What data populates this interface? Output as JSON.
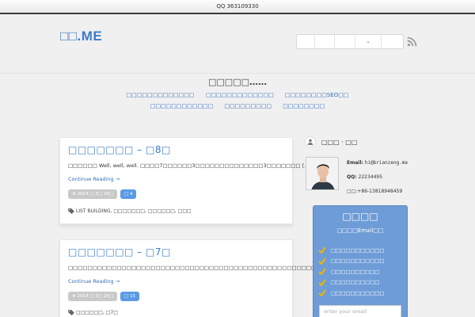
{
  "topbar": {
    "text": "QQ   363109330"
  },
  "header": {
    "logo": "□□.ME",
    "menu_chevron": "⌄"
  },
  "intro": {
    "title": "□□□□□……",
    "links_row1": [
      "□□□□□□□□□□□□□",
      "□□□□□□□□□□□□□",
      "□□□□□□□□SEO□□"
    ],
    "links_row2": [
      "□□□□□□□□□□□□",
      "□□□□□□□□□",
      "□□□□□□□□"
    ]
  },
  "posts": [
    {
      "title": "□□□□□□□ – □8□",
      "excerpt": "□□□□□□ Well, well, well. □□□□7□□□□□□3□□□□□□□□□□□□□□3□□□□□□□ […]",
      "more": "Continue Reading →",
      "date": "★ 2014 □ 3□ 29□",
      "comments": "□ 4",
      "tags": "LIST BUILDING,  □□□□□□□,  □□□□□□,  □□□"
    },
    {
      "title": "□□□□□□□ – □7□",
      "excerpt": "□□□□□□□□□□□□□□□□□□□□□□□□□□□□□□□□□□□□□□□□□□□□□□□□□□□□□□□□ […]",
      "more": "Continue Reading →",
      "date": "★ 2014 □ 3□ 26□",
      "comments": "□ 15",
      "tags": "□□□□□□,  □7□"
    }
  ],
  "author": {
    "name": "□□□ · □□",
    "email_label": "Email:",
    "email": "hi@brianzeng.me",
    "qq_label": "QQ:",
    "qq": "22234495",
    "phone": "□□:+86-13818948459"
  },
  "subscribe": {
    "title": "□□□□",
    "subtitle": "□□□□Email□□",
    "items": [
      "□□□□□□□□□□□",
      "□□□□□□□□□□□",
      "□□□□□□□□□□",
      "□□□□□□□□□□",
      "□□□□□□□□□□□"
    ],
    "input_placeholder": "enter your email"
  },
  "colors": {
    "accent": "#3d7bc7",
    "link": "#2f6fbe",
    "subscribe_bg": "#6e9cd7",
    "check": "#f0b400"
  }
}
